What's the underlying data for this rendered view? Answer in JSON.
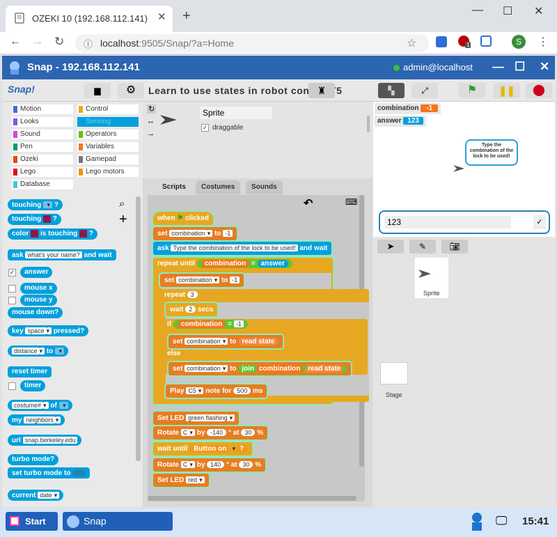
{
  "browser": {
    "tab_title": "OZEKI 10 (192.168.112.141)",
    "url_host": "localhost",
    "url_rest": ":9505/Snap/?a=Home",
    "ext_badge": "1",
    "profile_initial": "S"
  },
  "app": {
    "title": "Snap - 192.168.112.141",
    "user": "admin@localhost",
    "logo": "Snap!",
    "project_title": "Learn to use states in robot control T5"
  },
  "categories": [
    {
      "label": "Motion",
      "color": "#4a6cd4"
    },
    {
      "label": "Control",
      "color": "#e6a822"
    },
    {
      "label": "Looks",
      "color": "#8a55d7"
    },
    {
      "label": "Sensing",
      "color": "#04a0dc"
    },
    {
      "label": "Sound",
      "color": "#cf4ad9"
    },
    {
      "label": "Operators",
      "color": "#62c213"
    },
    {
      "label": "Pen",
      "color": "#0e9a6c"
    },
    {
      "label": "Variables",
      "color": "#f3761d"
    },
    {
      "label": "Ozeki",
      "color": "#d94d11"
    },
    {
      "label": "Gamepad",
      "color": "#777777"
    },
    {
      "label": "Lego",
      "color": "#e6001f"
    },
    {
      "label": "Lego motors",
      "color": "#f29100"
    },
    {
      "label": "Database",
      "color": "#4ac4d6"
    }
  ],
  "palette": {
    "touching": "touching",
    "color": "color",
    "is_touching": "is touching",
    "ask": "ask",
    "ask_default": "what's your name?",
    "and_wait": "and wait",
    "answer": "answer",
    "mouse_x": "mouse x",
    "mouse_y": "mouse y",
    "mouse_down": "mouse down?",
    "key": "key",
    "key_value": "space",
    "pressed": "pressed?",
    "distance": "distance",
    "to": "to",
    "reset_timer": "reset timer",
    "timer": "timer",
    "costume": "costume#",
    "of": "of",
    "my": "my",
    "neighbors": "neighbors",
    "url": "url",
    "url_value": "snap.berkeley.edu",
    "turbo_mode": "turbo mode?",
    "set_turbo": "set turbo mode to",
    "current": "current",
    "date": "date",
    "q": "?"
  },
  "sprite": {
    "name": "Sprite",
    "draggable": "draggable",
    "tabs": [
      "Scripts",
      "Costumes",
      "Sounds"
    ]
  },
  "script": {
    "when": "when",
    "clicked": "clicked",
    "set": "set",
    "combination": "combination",
    "to": "to",
    "neg1": "-1",
    "ask": "ask",
    "question": "Type the combination of the lock to be used!",
    "and_wait": "and wait",
    "repeat_until": "repeat until",
    "eq": "=",
    "answer": "answer",
    "repeat": "repeat",
    "three": "3",
    "wait": "wait",
    "two": "2",
    "secs": "secs",
    "if": "if",
    "read_state": "read state",
    "else": "else",
    "join": "join",
    "play": "Play",
    "c5": "C5",
    "note_for": "note for",
    "ms500": "500",
    "ms": "ms",
    "set_led": "Set LED",
    "green_flashing": "green flashing",
    "rotate": "Rotate",
    "c": "C",
    "by": "by",
    "n140": "-140",
    "p140": "140",
    "deg_at": "° at",
    "thirty": "30",
    "pct": "%",
    "wait_until": "wait until",
    "button_on": "Button on",
    "q": "?",
    "red": "red"
  },
  "stage": {
    "watchers": [
      {
        "label": "combination",
        "value": "-1",
        "color": "#f3761d"
      },
      {
        "label": "answer",
        "value": "123",
        "color": "#04a0dc"
      }
    ],
    "bubble": "Type the combination of the lock to be used!",
    "answer_input": "123"
  },
  "corral": {
    "sprite_label": "Sprite",
    "stage_label": "Stage"
  },
  "taskbar": {
    "start": "Start",
    "app": "Snap",
    "time": "15:41"
  }
}
